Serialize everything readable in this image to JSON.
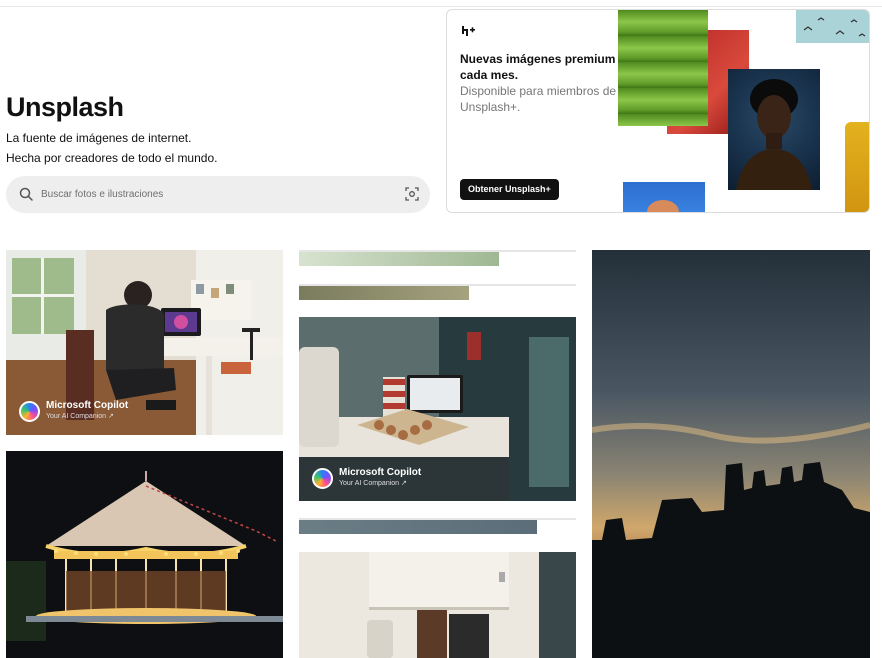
{
  "brand": {
    "title": "Unsplash",
    "tagline_1": "La fuente de imágenes de internet.",
    "tagline_2": "Hecha por creadores de todo el mundo."
  },
  "search": {
    "placeholder": "Buscar fotos e ilustraciones"
  },
  "promo": {
    "title": "Nuevas imágenes premium cada mes.",
    "subtitle": "Disponible para miembros de Unsplash+.",
    "button_label": "Obtener Unsplash+"
  },
  "sponsored": [
    {
      "name": "Microsoft Copilot",
      "tagline": "Your AI Companion ↗"
    },
    {
      "name": "Microsoft Copilot",
      "tagline": "Your AI Companion ↗"
    }
  ],
  "colors": {
    "text": "#111111",
    "muted": "#767676",
    "search_bg": "#eeeeee",
    "button_bg": "#111111"
  }
}
